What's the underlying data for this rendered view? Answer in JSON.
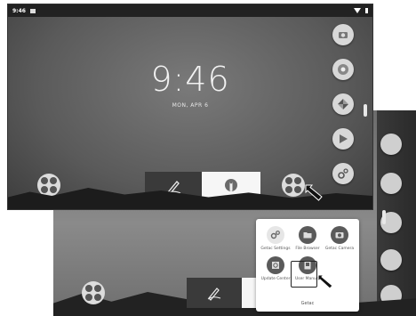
{
  "front": {
    "status": {
      "time": "9:46"
    },
    "clock": "9:46",
    "date": "MON, APR 6",
    "dock": [
      {
        "icon": "camera-icon"
      },
      {
        "icon": "chrome-icon"
      },
      {
        "icon": "pinwheel-icon"
      },
      {
        "icon": "play-store-icon"
      },
      {
        "icon": "settings-icon"
      }
    ]
  },
  "popup": {
    "title": "Getac",
    "apps": [
      {
        "label": "Getac Settings",
        "icon": "settings-gears-icon"
      },
      {
        "label": "File Browser",
        "icon": "folder-icon"
      },
      {
        "label": "Getac Camera",
        "icon": "camera-icon"
      },
      {
        "label": "Update Center",
        "icon": "update-icon"
      },
      {
        "label": "User Manual",
        "icon": "manual-icon"
      }
    ]
  },
  "colors": {
    "screen_dark": "#5a5a5a",
    "status_bar": "#222222",
    "popup_bg": "#ffffff"
  }
}
